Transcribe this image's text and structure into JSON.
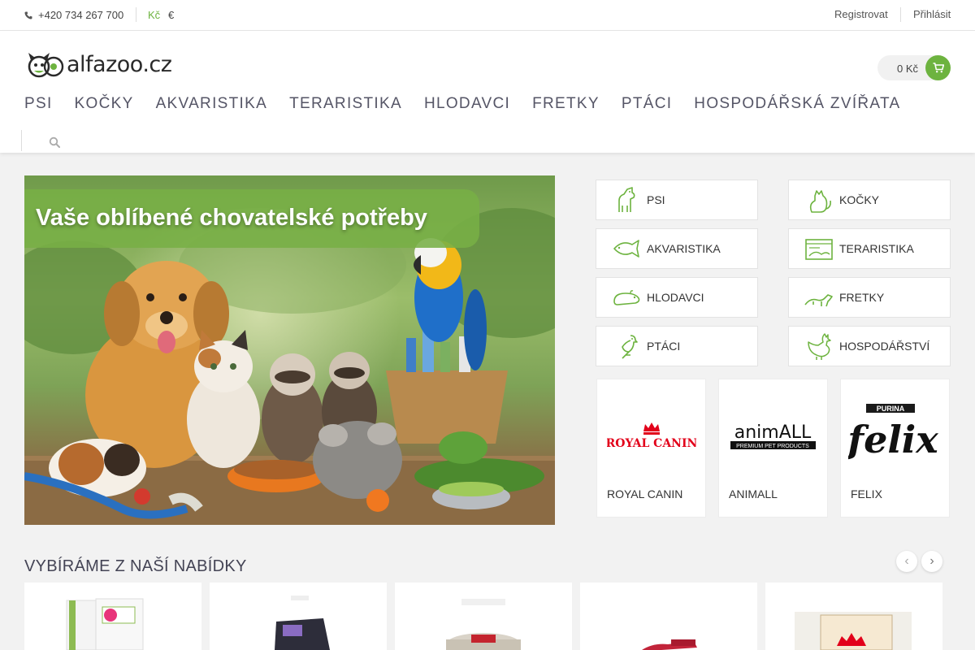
{
  "topbar": {
    "phone": "+420 734 267 700",
    "currency_active": "Kč",
    "currency_other": "€",
    "register": "Registrovat",
    "login": "Přihlásit"
  },
  "header": {
    "logo_text": "alfazoo.cz",
    "cart_total": "0 Kč",
    "nav": [
      "PSI",
      "KOČKY",
      "AKVARISTIKA",
      "TERARISTIKA",
      "HLODAVCI",
      "FRETKY",
      "PTÁCI",
      "HOSPODÁŘSKÁ ZVÍŘATA"
    ]
  },
  "banner": {
    "headline": "Vaše oblíbené chovatelské potřeby"
  },
  "categories": [
    {
      "label": "PSI",
      "icon": "dog-icon"
    },
    {
      "label": "KOČKY",
      "icon": "cat-icon"
    },
    {
      "label": "AKVARISTIKA",
      "icon": "fish-icon"
    },
    {
      "label": "TERARISTIKA",
      "icon": "terrarium-icon"
    },
    {
      "label": "HLODAVCI",
      "icon": "rodent-icon"
    },
    {
      "label": "FRETKY",
      "icon": "ferret-icon"
    },
    {
      "label": "PTÁCI",
      "icon": "bird-icon"
    },
    {
      "label": "HOSPODÁŘSTVÍ",
      "icon": "rooster-icon"
    }
  ],
  "brands": [
    {
      "name": "ROYAL CANIN",
      "logo_text": "ROYAL CANIN"
    },
    {
      "name": "ANIMALL",
      "logo_text": "animALL",
      "logo_sub": "PREMIUM PET PRODUCTS"
    },
    {
      "name": "FELIX",
      "logo_text": "felix",
      "logo_top": "PURINA"
    }
  ],
  "offers": {
    "title": "VYBÍRÁME Z NAŠÍ NABÍDKY",
    "prev": "‹",
    "next": "›"
  },
  "colors": {
    "accent": "#6db33f",
    "royal_canin": "#e2001a"
  }
}
